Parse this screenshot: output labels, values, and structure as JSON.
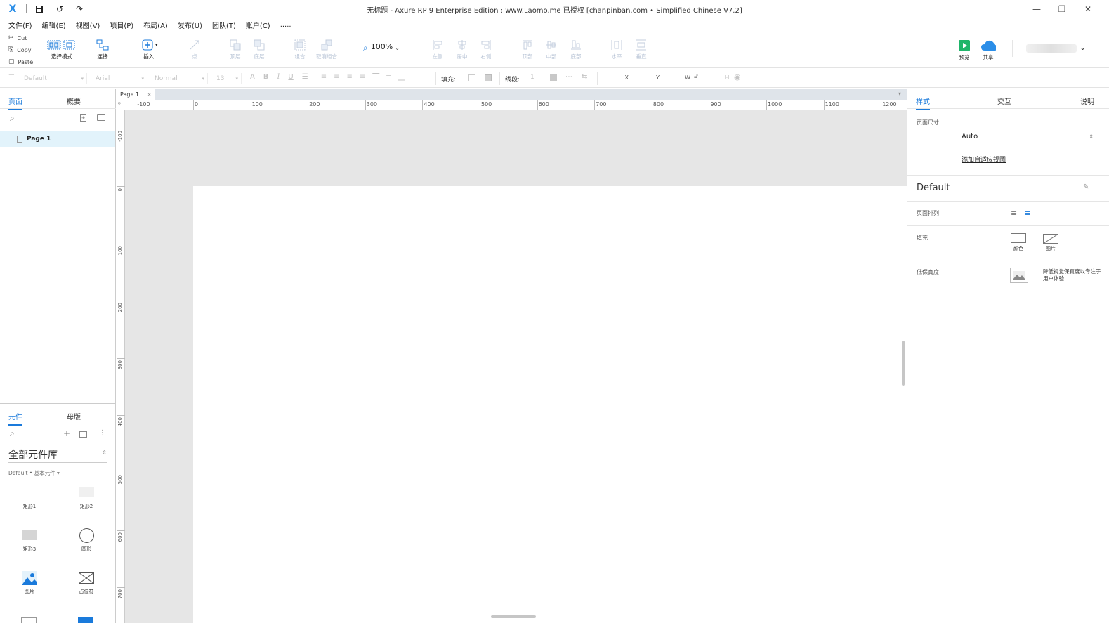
{
  "titlebar": {
    "title": "无标题 - Axure RP 9 Enterprise Edition : www.Laomo.me 已授权    [chanpinban.com • Simplified Chinese V7.2]",
    "minimize": "—",
    "restore": "❐",
    "close": "✕"
  },
  "menu": [
    "文件(F)",
    "编辑(E)",
    "视图(V)",
    "项目(P)",
    "布局(A)",
    "发布(U)",
    "团队(T)",
    "账户(C)",
    "....."
  ],
  "clipboard": {
    "cut": "Cut",
    "copy": "Copy",
    "paste": "Paste"
  },
  "toolbar": {
    "select_mode": "选择模式",
    "connect": "连接",
    "insert": "插入",
    "point": "点",
    "top_layer": "顶层",
    "bottom_layer": "底层",
    "group": "组合",
    "ungroup": "取消组合",
    "zoom": "100%",
    "align_left": "左侧",
    "align_center": "居中",
    "align_right": "右侧",
    "align_top": "顶部",
    "align_middle": "中部",
    "align_bottom": "底部",
    "dist_h": "水平",
    "dist_v": "垂直",
    "preview": "预览",
    "share": "共享"
  },
  "formatbar": {
    "style": "Default",
    "font": "Arial",
    "weight": "Normal",
    "size": "13",
    "fill_label": "填充:",
    "line_label": "线段:",
    "line_value": "1",
    "x": "X",
    "y": "Y",
    "w": "W",
    "h": "H"
  },
  "pages_panel": {
    "tab_pages": "页面",
    "tab_outline": "概要",
    "items": [
      "Page 1"
    ]
  },
  "widgets_panel": {
    "tab_widgets": "元件",
    "tab_masters": "母版",
    "library": "全部元件库",
    "sublib": "Default • 基本元件 ▾",
    "items": [
      "矩形1",
      "矩形2",
      "矩形3",
      "圆形",
      "图片",
      "占位符"
    ]
  },
  "canvas": {
    "tab": "Page 1",
    "h_ticks": [
      "-100",
      "0",
      "100",
      "200",
      "300",
      "400",
      "500",
      "600",
      "700",
      "800",
      "900",
      "1000",
      "1100",
      "1200"
    ],
    "v_ticks": [
      "-100",
      "0",
      "100",
      "200",
      "300",
      "400",
      "500",
      "600",
      "700"
    ]
  },
  "inspector": {
    "tab_style": "样式",
    "tab_interact": "交互",
    "tab_notes": "说明",
    "page_size_label": "页面尺寸",
    "page_size_value": "Auto",
    "adaptive_link": "添加自适应视图",
    "style_name": "Default",
    "align_label": "页面排列",
    "fill_label": "填充",
    "fill_color": "颜色",
    "fill_image": "图片",
    "lowfi_label": "低保真度",
    "lowfi_desc": "降低视觉保真度以专注于用户体验"
  },
  "colors": {
    "accent": "#1a7adb",
    "preview_green": "#1fb56a",
    "share_blue": "#2b8ee8"
  }
}
